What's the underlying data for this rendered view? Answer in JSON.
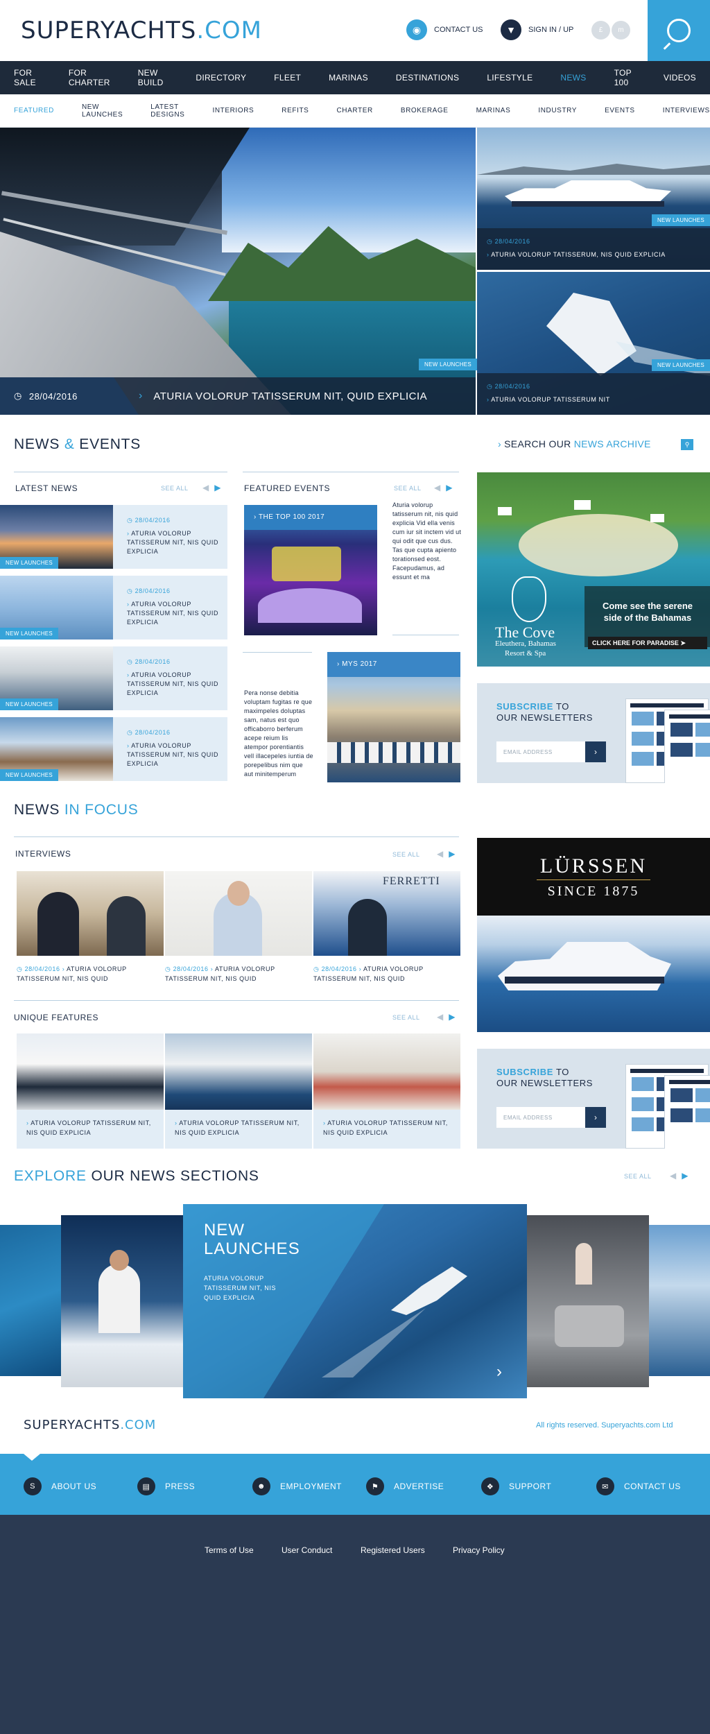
{
  "header": {
    "logo_a": "SUPERYACHTS",
    "logo_b": ".COM",
    "contact": "CONTACT US",
    "signin": "SIGN IN / UP",
    "lang1": "£",
    "lang2": "m",
    "accent": "#36a3d9",
    "dark": "#1e2a3a"
  },
  "mainnav": [
    "FOR SALE",
    "FOR CHARTER",
    "NEW BUILD",
    "DIRECTORY",
    "FLEET",
    "MARINAS",
    "DESTINATIONS",
    "LIFESTYLE",
    "NEWS",
    "TOP 100",
    "VIDEOS"
  ],
  "mainnav_active": "NEWS",
  "subnav": [
    "FEATURED",
    "NEW LAUNCHES",
    "LATEST DESIGNS",
    "INTERIORS",
    "REFITS",
    "CHARTER",
    "BROKERAGE",
    "MARINAS",
    "INDUSTRY",
    "EVENTS",
    "INTERVIEWS"
  ],
  "subnav_active": "FEATURED",
  "hero": {
    "tag": "NEW LAUNCHES",
    "date": "28/04/2016",
    "title": "ATURIA VOLORUP TATISSERUM NIT, QUID EXPLICIA",
    "side1": {
      "tag": "NEW LAUNCHES",
      "date": "28/04/2016",
      "title": "ATURIA VOLORUP TATISSERUM, NIS QUID EXPLICIA"
    },
    "side2": {
      "tag": "NEW LAUNCHES",
      "date": "28/04/2016",
      "title": "ATURIA VOLORUP TATISSERUM NIT"
    }
  },
  "news_events": {
    "title_a": "NEWS",
    "title_amp": "&",
    "title_b": "EVENTS",
    "archive_a": "SEARCH OUR",
    "archive_b": "NEWS ARCHIVE",
    "latest_news": "LATEST NEWS",
    "featured_events": "FEATURED EVENTS",
    "see_all": "SEE ALL",
    "items": [
      {
        "tag": "NEW LAUNCHES",
        "date": "28/04/2016",
        "title": "ATURIA VOLORUP TATISSERUM NIT, NIS QUID EXPLICIA"
      },
      {
        "tag": "NEW LAUNCHES",
        "date": "28/04/2016",
        "title": "ATURIA VOLORUP TATISSERUM NIT, NIS QUID EXPLICIA"
      },
      {
        "tag": "NEW LAUNCHES",
        "date": "28/04/2016",
        "title": "ATURIA VOLORUP TATISSERUM NIT, NIS QUID EXPLICIA"
      },
      {
        "tag": "NEW LAUNCHES",
        "date": "28/04/2016",
        "title": "ATURIA VOLORUP TATISSERUM NIT, NIS QUID EXPLICIA"
      }
    ],
    "event1": {
      "label": "THE TOP 100 2017",
      "text": "Aturia volorup tatisserum nit, nis quid explicia Vid ella venis cum iur sit inctem vid ut qui odit que cus dus. Tas que cupta apiento torationsed eost. Facepudamus, ad essunt et ma"
    },
    "event2": {
      "label": "MYS 2017",
      "text": "Pera nonse debitia voluptam fugitas re que maximpeles doluptas sam, natus est quo officaborro berferum acepe reium lis atempor porentiantis vell illacepeles iuntia de porepelibus nim que aut minitemperum"
    }
  },
  "promo_cove": {
    "name": "The Cove",
    "loc": "Eleuthera, Bahamas",
    "sub": "Resort & Spa",
    "line1": "Come see the serene",
    "line2": "side of the Bahamas",
    "cta": "CLICK HERE FOR PARADISE"
  },
  "subscribe": {
    "a": "SUBSCRIBE",
    "b": "TO",
    "c": "OUR NEWSLETTERS",
    "placeholder": "EMAIL ADDRESS",
    "mag": "SUPERYACHTS"
  },
  "focus": {
    "title_a": "NEWS",
    "title_b": "IN FOCUS",
    "interviews": "INTERVIEWS",
    "see_all": "SEE ALL",
    "items": [
      {
        "date": "28/04/2016",
        "title": "ATURIA VOLORUP TATISSERUM NIT, NIS QUID"
      },
      {
        "date": "28/04/2016",
        "title": "ATURIA VOLORUP TATISSERUM NIT, NIS QUID"
      },
      {
        "date": "28/04/2016",
        "title": "ATURIA VOLORUP TATISSERUM NIT, NIS QUID"
      }
    ],
    "interview3_brand": "FERRETTI",
    "unique": "UNIQUE FEATURES",
    "uf_items": [
      {
        "title": "ATURIA VOLORUP TATISSERUM NIT, NIS QUID EXPLICIA"
      },
      {
        "title": "ATURIA VOLORUP TATISSERUM NIT, NIS QUID EXPLICIA"
      },
      {
        "title": "ATURIA VOLORUP TATISSERUM NIT, NIS QUID EXPLICIA"
      }
    ]
  },
  "lurssen": {
    "brand": "LÜRSSEN",
    "since": "SINCE 1875"
  },
  "explore": {
    "title_a": "EXPLORE",
    "title_b": "OUR NEWS SECTIONS",
    "see_all": "SEE ALL",
    "featured_title_1": "NEW",
    "featured_title_2": "LAUNCHES",
    "featured_text": "ATURIA VOLORUP TATISSERUM NIT, NIS QUID EXPLICIA"
  },
  "footer": {
    "logo_a": "SUPERYACHTS",
    "logo_b": ".COM",
    "rights": "All rights reserved. Superyachts.com Ltd",
    "links": [
      "ABOUT US",
      "PRESS",
      "EMPLOYMENT",
      "ADVERTISE",
      "SUPPORT",
      "CONTACT US"
    ],
    "legal": [
      "Terms of Use",
      "User Conduct",
      "Registered Users",
      "Privacy Policy"
    ]
  }
}
